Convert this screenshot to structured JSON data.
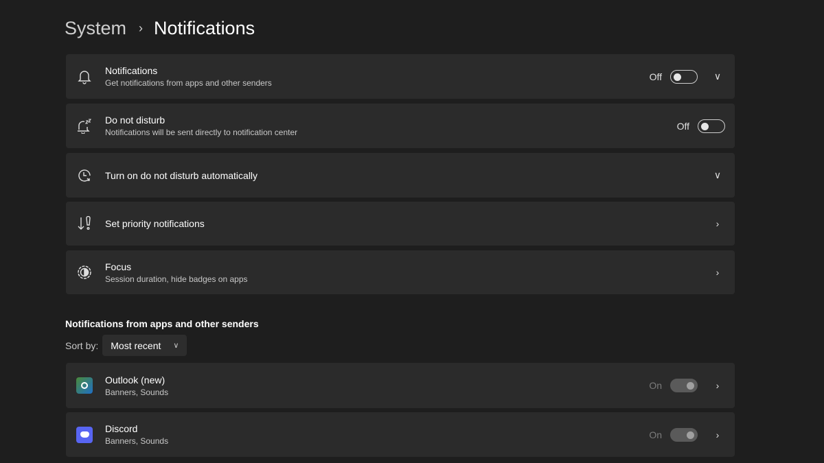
{
  "breadcrumb": {
    "parent": "System",
    "current": "Notifications"
  },
  "settings": [
    {
      "icon": "bell-icon",
      "title": "Notifications",
      "sub": "Get notifications from apps and other senders",
      "state": "Off",
      "chevron": "down"
    },
    {
      "icon": "bell-snooze-icon",
      "title": "Do not disturb",
      "sub": "Notifications will be sent directly to notification center",
      "state": "Off"
    },
    {
      "icon": "clock-icon",
      "title": "Turn on do not disturb automatically",
      "chevron": "down"
    },
    {
      "icon": "priority-icon",
      "title": "Set priority notifications",
      "chevron": "right"
    },
    {
      "icon": "focus-icon",
      "title": "Focus",
      "sub": "Session duration, hide badges on apps",
      "chevron": "right"
    }
  ],
  "apps_section": {
    "title": "Notifications from apps and other senders",
    "sort_label": "Sort by:",
    "sort_value": "Most recent"
  },
  "apps": [
    {
      "icon": "outlook-icon",
      "name": "Outlook (new)",
      "sub": "Banners, Sounds",
      "state": "On",
      "color": "#1f6fc5"
    },
    {
      "icon": "discord-icon",
      "name": "Discord",
      "sub": "Banners, Sounds",
      "state": "On",
      "color": "#5865f2"
    }
  ]
}
